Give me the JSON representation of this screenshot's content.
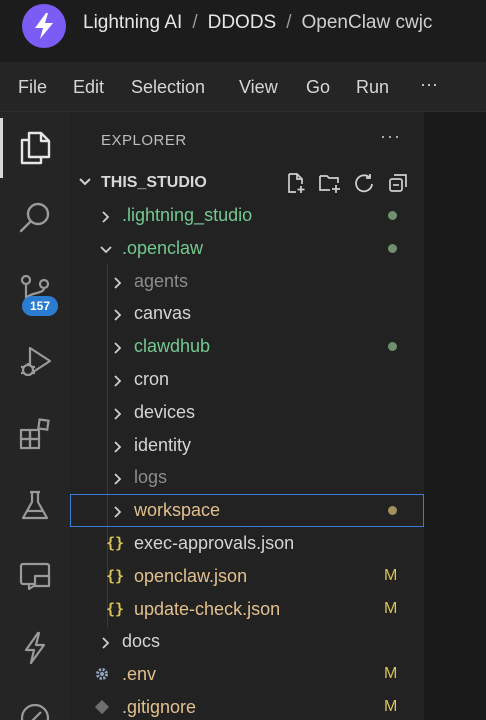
{
  "titlebar": {
    "breadcrumb": [
      "Lightning AI",
      "DDODS",
      "OpenClaw cwjc"
    ]
  },
  "menubar": {
    "items": [
      "File",
      "Edit",
      "Selection",
      "View",
      "Go",
      "Run"
    ],
    "more": "···"
  },
  "activitybar": {
    "icons": [
      "explorer-icon",
      "search-icon",
      "source-control-icon",
      "run-debug-icon",
      "extensions-icon",
      "testing-icon",
      "remote-explorer-icon",
      "lightning-icon",
      "accounts-icon"
    ],
    "source_control_badge": "157"
  },
  "explorer": {
    "title": "EXPLORER",
    "more": "···",
    "section_label": "THIS_STUDIO",
    "colors": {
      "untracked": "#73c991",
      "modified": "#e2c08d",
      "ignored": "#8c8c8c",
      "normal": "#d4d4d4",
      "selection_border": "#3a7bd5"
    },
    "tree": [
      {
        "name": ".lightning_studio",
        "kind": "folder",
        "depth": 1,
        "expanded": false,
        "color": "#73c991",
        "dot": "#6f8f6f"
      },
      {
        "name": ".openclaw",
        "kind": "folder",
        "depth": 1,
        "expanded": true,
        "color": "#73c991",
        "dot": "#6f8f6f"
      },
      {
        "name": "agents",
        "kind": "folder",
        "depth": 2,
        "expanded": false,
        "color": "#8c8c8c"
      },
      {
        "name": "canvas",
        "kind": "folder",
        "depth": 2,
        "expanded": false,
        "color": "#d4d4d4"
      },
      {
        "name": "clawdhub",
        "kind": "folder",
        "depth": 2,
        "expanded": false,
        "color": "#73c991",
        "dot": "#6f8f6f"
      },
      {
        "name": "cron",
        "kind": "folder",
        "depth": 2,
        "expanded": false,
        "color": "#d4d4d4"
      },
      {
        "name": "devices",
        "kind": "folder",
        "depth": 2,
        "expanded": false,
        "color": "#d4d4d4"
      },
      {
        "name": "identity",
        "kind": "folder",
        "depth": 2,
        "expanded": false,
        "color": "#d4d4d4"
      },
      {
        "name": "logs",
        "kind": "folder",
        "depth": 2,
        "expanded": false,
        "color": "#8c8c8c"
      },
      {
        "name": "workspace",
        "kind": "folder",
        "depth": 2,
        "expanded": false,
        "color": "#e2c08d",
        "dot": "#a38f5f",
        "selected": true
      },
      {
        "name": "exec-approvals.json",
        "kind": "json",
        "depth": 2,
        "color": "#d4d4d4"
      },
      {
        "name": "openclaw.json",
        "kind": "json",
        "depth": 2,
        "color": "#e2c08d",
        "status": "M"
      },
      {
        "name": "update-check.json",
        "kind": "json",
        "depth": 2,
        "color": "#e2c08d",
        "status": "M"
      },
      {
        "name": "docs",
        "kind": "folder",
        "depth": 1,
        "expanded": false,
        "color": "#d4d4d4"
      },
      {
        "name": ".env",
        "kind": "gear",
        "depth": 1,
        "color": "#e2c08d",
        "status": "M"
      },
      {
        "name": ".gitignore",
        "kind": "git",
        "depth": 1,
        "color": "#e2c08d",
        "status": "M"
      }
    ]
  }
}
